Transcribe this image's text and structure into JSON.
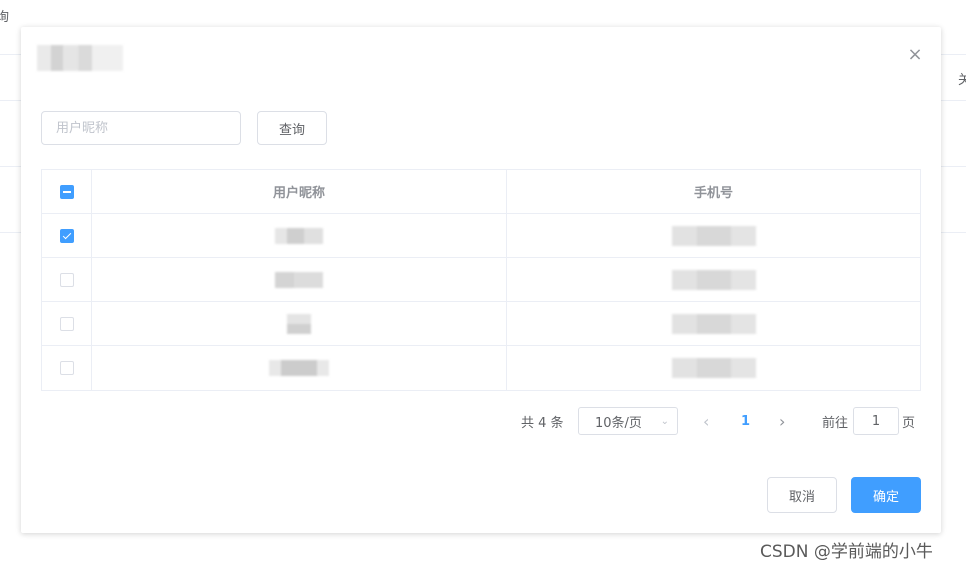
{
  "background": {
    "left_fragment": "询",
    "right_fragment": "关"
  },
  "dialog": {
    "close_symbol": "×",
    "search": {
      "placeholder": "用户昵称",
      "value": ""
    },
    "query_button": "查询",
    "table": {
      "columns": [
        "用户昵称",
        "手机号"
      ],
      "header_checkbox_state": "indeterminate",
      "rows": [
        {
          "checked": true
        },
        {
          "checked": false
        },
        {
          "checked": false
        },
        {
          "checked": false
        }
      ]
    },
    "pagination": {
      "total_label": "共 4 条",
      "page_size_label": "10条/页",
      "prev_icon": "‹",
      "current_page": "1",
      "next_icon": "›",
      "goto_label": "前往",
      "goto_value": "1",
      "page_suffix": "页"
    },
    "footer": {
      "cancel": "取消",
      "confirm": "确定"
    }
  },
  "colors": {
    "primary": "#409eff",
    "border": "#dcdfe6"
  },
  "watermark": "CSDN @学前端的小牛"
}
